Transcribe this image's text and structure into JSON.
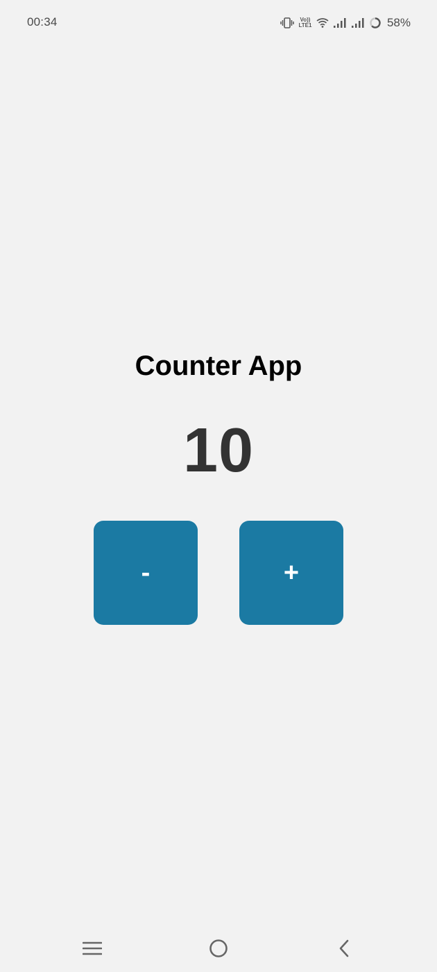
{
  "status_bar": {
    "time": "00:34",
    "volte_line1": "Vo))",
    "volte_line2": "LTE1",
    "battery": "58%",
    "icons": [
      "vibrate-icon",
      "volte-icon",
      "wifi-icon",
      "signal-icon",
      "signal-icon",
      "battery-ring-icon"
    ]
  },
  "app": {
    "title": "Counter App",
    "count": "10",
    "decrement_label": "-",
    "increment_label": "+",
    "button_color": "#1b7aa3"
  },
  "nav_bar": {
    "icons": [
      "menu-icon",
      "home-icon",
      "back-icon"
    ]
  }
}
